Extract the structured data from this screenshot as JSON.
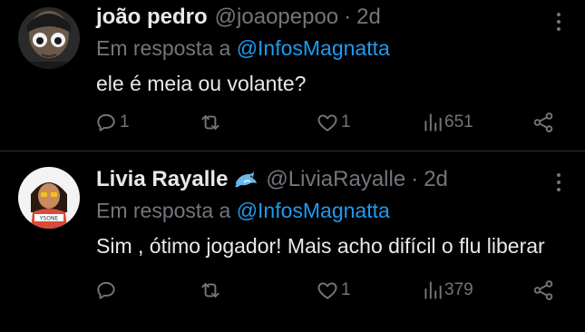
{
  "tweets": [
    {
      "name": "joão pedro",
      "handle": "@joaopepoo",
      "separator": "·",
      "time": "2d",
      "reply_prefix": "Em resposta a ",
      "reply_mention": "@InfosMagnatta",
      "text": "ele é meia ou volante?",
      "replies": "1",
      "retweets": "",
      "likes": "1",
      "views": "651"
    },
    {
      "name": "Livia Rayalle",
      "emoji": "dolphin-emoji",
      "handle": "@LiviaRayalle",
      "separator": "·",
      "time": "2d",
      "reply_prefix": "Em resposta a ",
      "reply_mention": "@InfosMagnatta",
      "text": "Sim , ótimo jogador! Mais acho difícil o flu liberar",
      "replies": "",
      "retweets": "",
      "likes": "1",
      "views": "379"
    }
  ],
  "colors": {
    "background": "#000000",
    "text": "#e7e9ea",
    "secondary": "#71767b",
    "link": "#1d9bf0",
    "divider": "#2f3336"
  },
  "icons": [
    "reply-icon",
    "retweet-icon",
    "like-icon",
    "views-icon",
    "share-icon",
    "more-icon"
  ]
}
